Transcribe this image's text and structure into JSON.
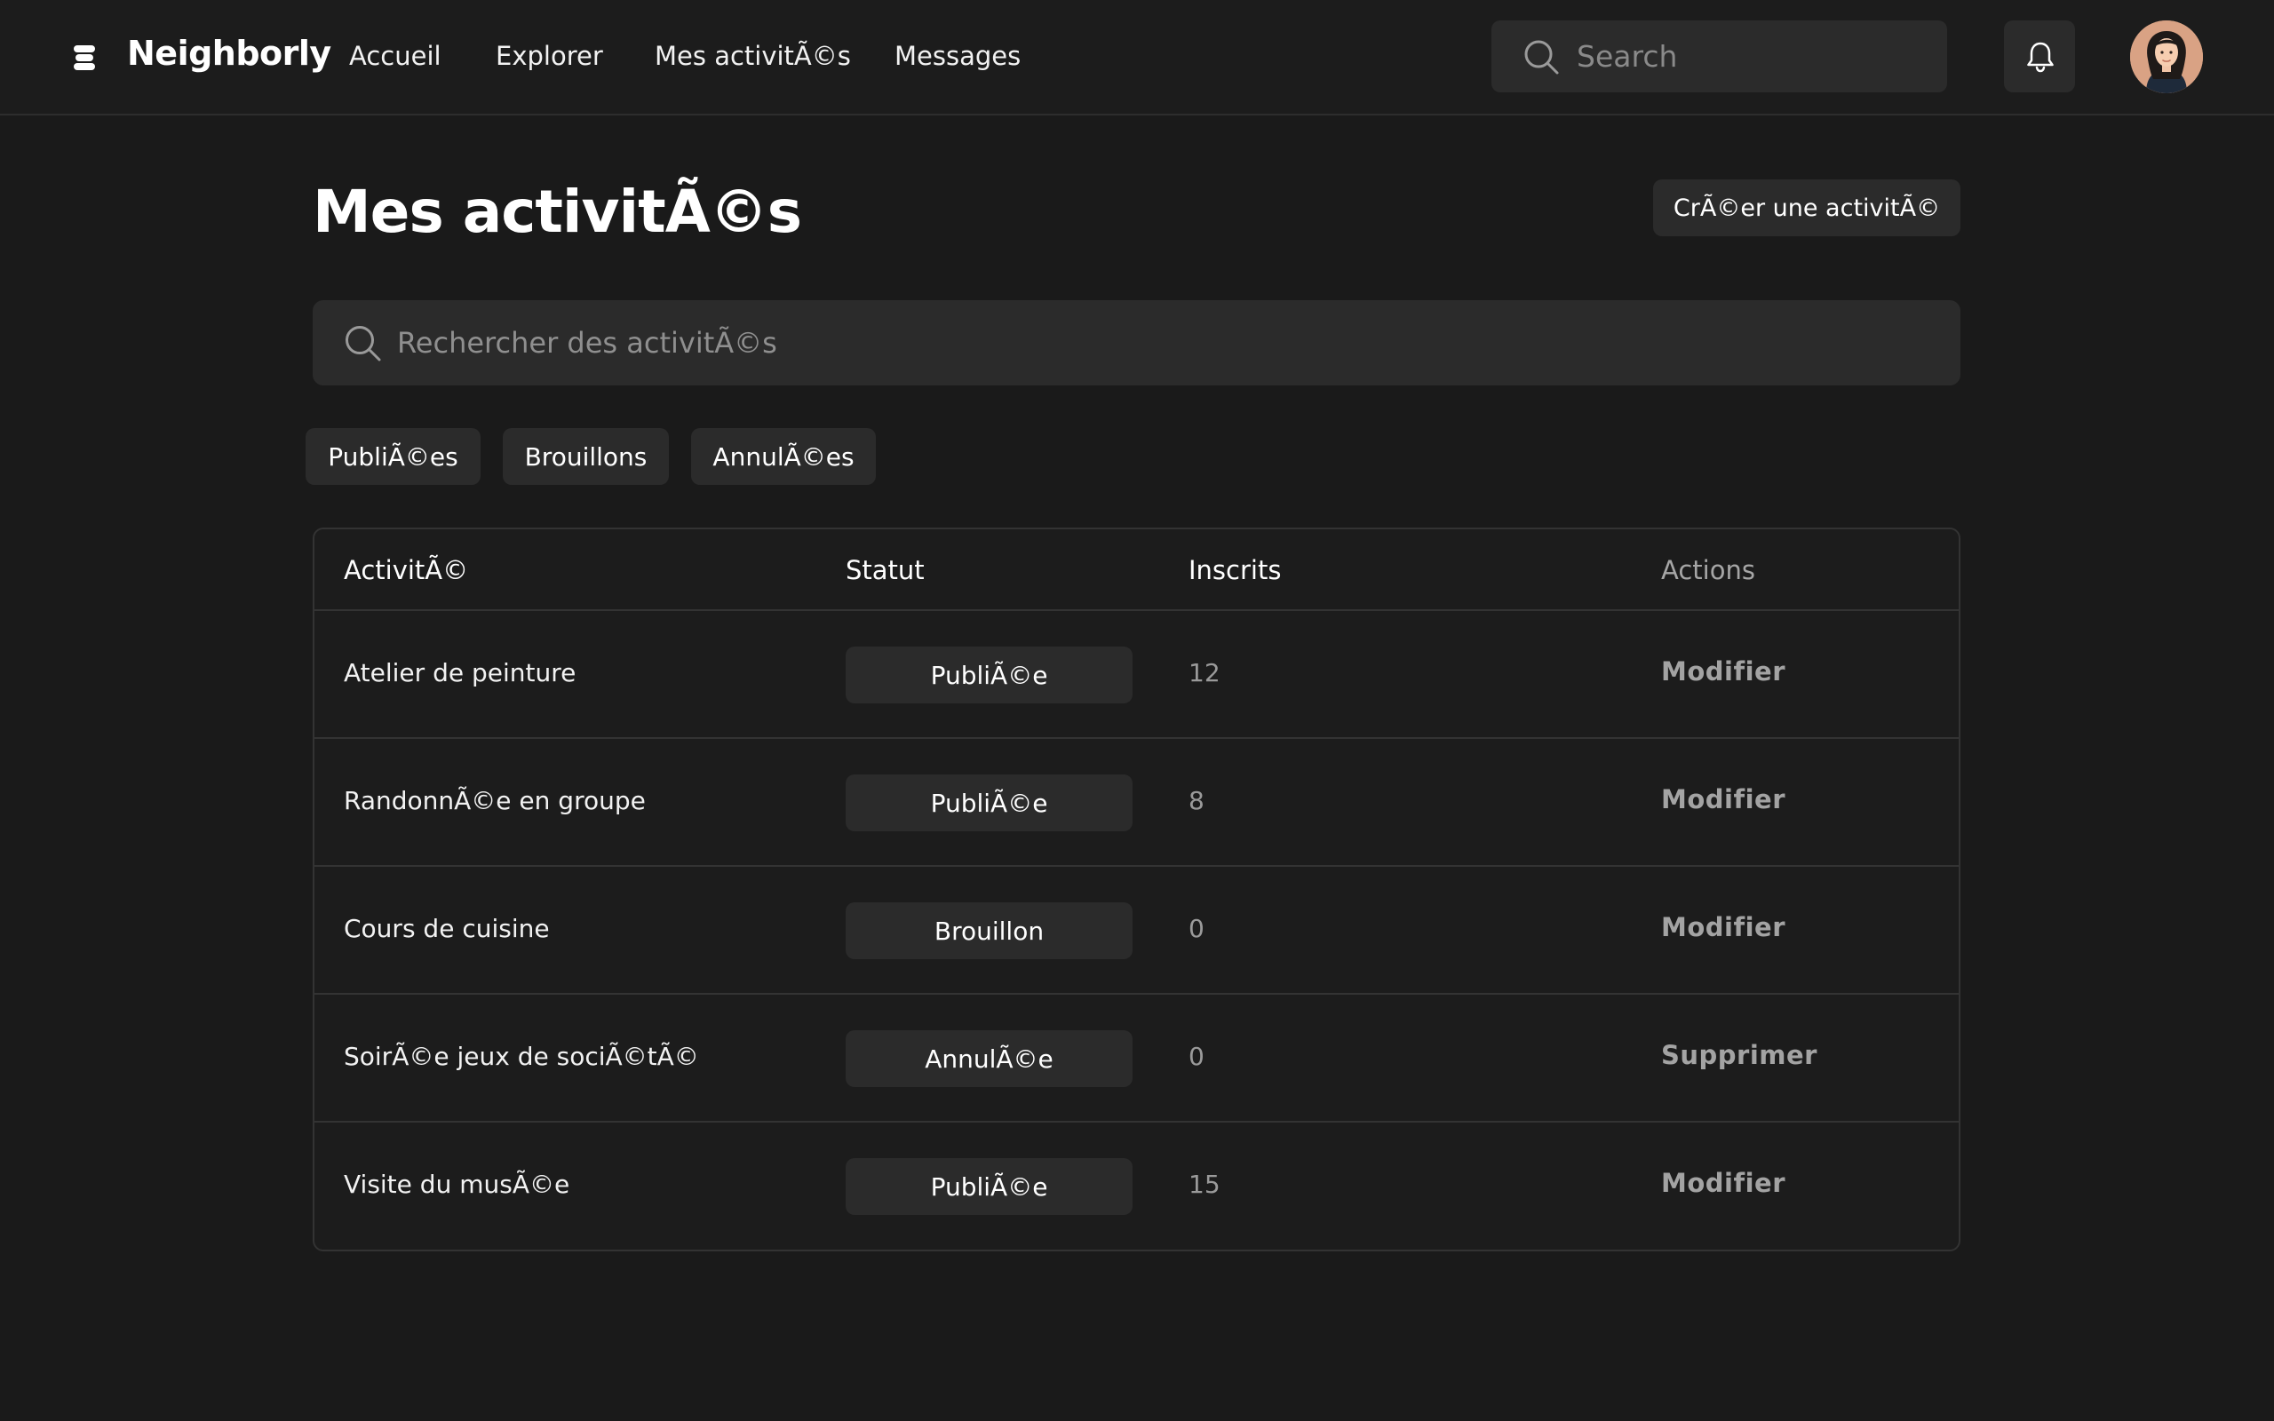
{
  "app": {
    "brand": "Neighborly",
    "logo_icon": "layers-icon"
  },
  "nav": {
    "items": [
      {
        "label": "Accueil"
      },
      {
        "label": "Explorer"
      },
      {
        "label": "Mes activitÃ©s"
      },
      {
        "label": "Messages"
      }
    ]
  },
  "top_search": {
    "placeholder": "Search",
    "icon": "search-icon"
  },
  "notifications": {
    "icon": "bell-icon"
  },
  "user": {
    "avatar": "user-avatar"
  },
  "page": {
    "title": "Mes activitÃ©s",
    "create_label": "CrÃ©er une activitÃ©"
  },
  "activity_search": {
    "placeholder": "Rechercher des activitÃ©s",
    "icon": "search-icon"
  },
  "filters": [
    {
      "label": "PubliÃ©es"
    },
    {
      "label": "Brouillons"
    },
    {
      "label": "AnnulÃ©es"
    }
  ],
  "table": {
    "headers": {
      "activity": "ActivitÃ©",
      "status": "Statut",
      "registered": "Inscrits",
      "actions": "Actions"
    },
    "rows": [
      {
        "name": "Atelier de peinture",
        "status": "PubliÃ©e",
        "count": "12",
        "action": "Modifier"
      },
      {
        "name": "RandonnÃ©e en groupe",
        "status": "PubliÃ©e",
        "count": "8",
        "action": "Modifier"
      },
      {
        "name": "Cours de cuisine",
        "status": "Brouillon",
        "count": "0",
        "action": "Modifier"
      },
      {
        "name": "SoirÃ©e jeux de sociÃ©tÃ©",
        "status": "AnnulÃ©e",
        "count": "0",
        "action": "Supprimer"
      },
      {
        "name": "Visite du musÃ©e",
        "status": "PubliÃ©e",
        "count": "15",
        "action": "Modifier"
      }
    ]
  },
  "colors": {
    "background": "#1a1a1a",
    "surface": "#2b2b2b",
    "border": "#333333",
    "text": "#ffffff",
    "muted": "#a3a3a3"
  }
}
